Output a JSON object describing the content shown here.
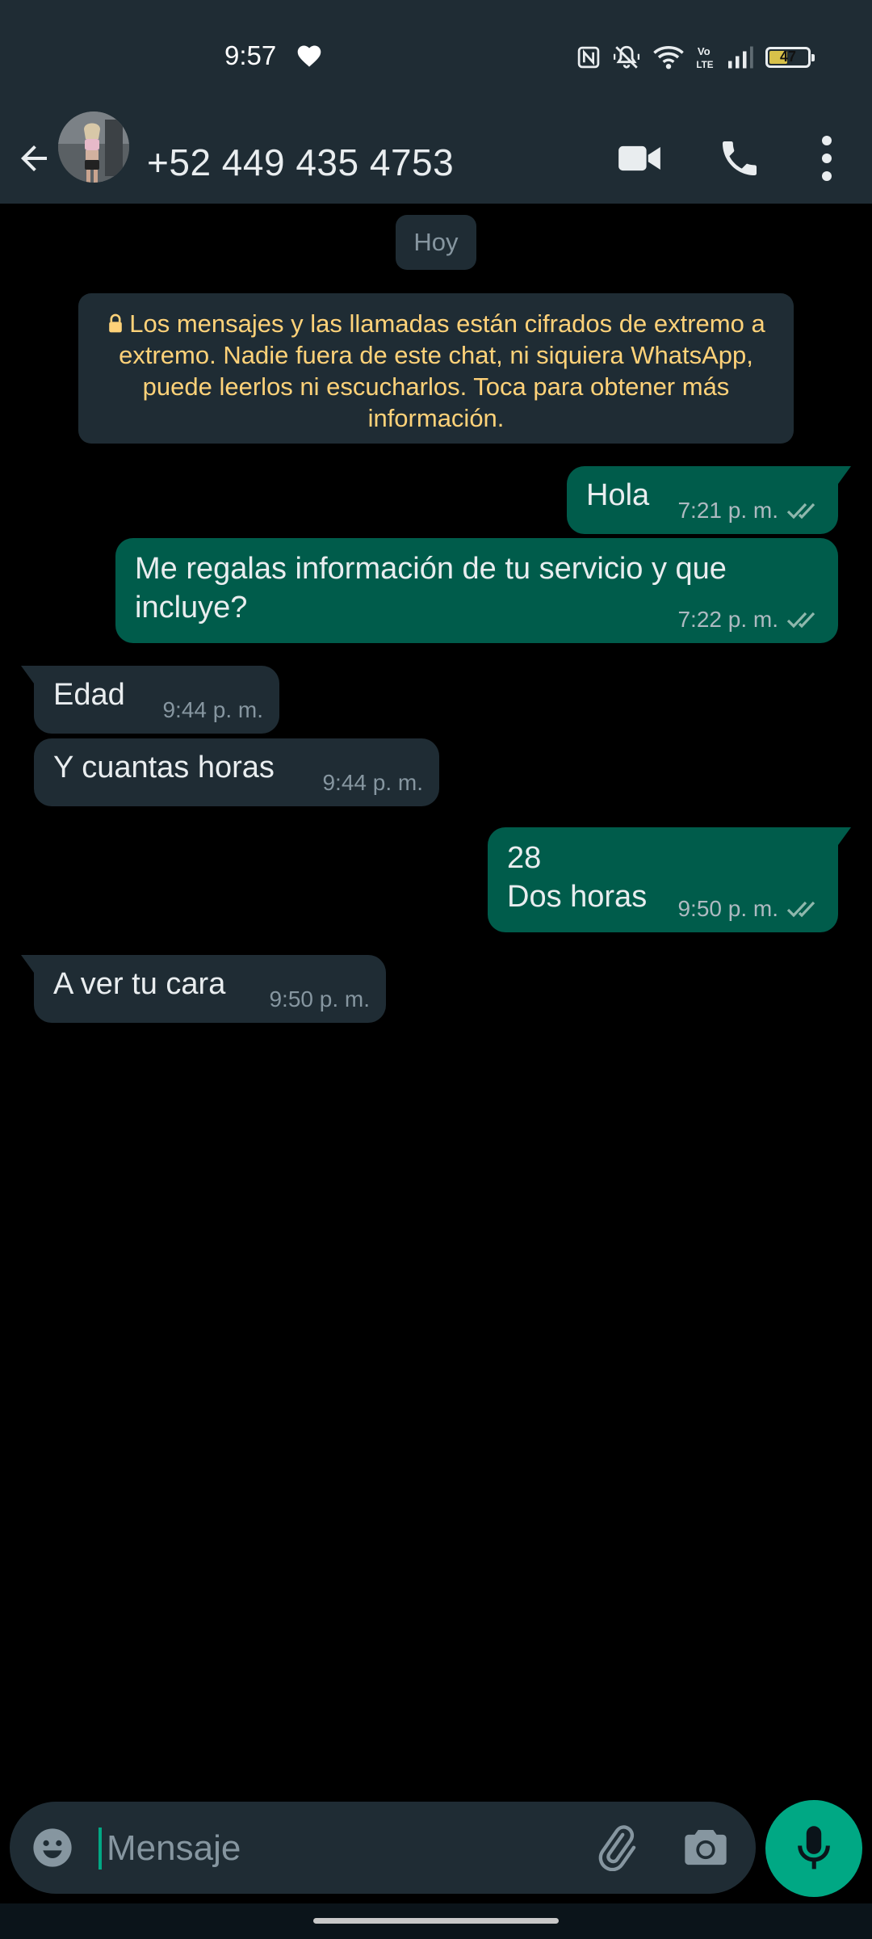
{
  "status_bar": {
    "time": "9:57",
    "battery_level": "47",
    "icons": [
      "heart-icon",
      "nfc-icon",
      "vibrate-off-icon",
      "wifi-icon",
      "volte-icon",
      "signal-icon",
      "battery-icon"
    ]
  },
  "header": {
    "contact": "+52 449 435 4753",
    "icons": [
      "back-arrow-icon",
      "avatar",
      "video-call-icon",
      "phone-icon",
      "more-vert-icon"
    ]
  },
  "chat": {
    "date_chip": "Hoy",
    "encryption_notice": "Los mensajes y las llamadas están cifrados de extremo a extremo. Nadie fuera de este chat, ni siquiera WhatsApp, puede leerlos ni escucharlos. Toca para obtener más información.",
    "messages": [
      {
        "direction": "out",
        "text": "Hola",
        "time": "7:21 p. m.",
        "status": "read"
      },
      {
        "direction": "out",
        "text": "Me regalas información de tu servicio y que incluye?",
        "time": "7:22 p. m.",
        "status": "read"
      },
      {
        "direction": "in",
        "text": "Edad",
        "time": "9:44 p. m."
      },
      {
        "direction": "in",
        "text": "Y cuantas horas",
        "time": "9:44 p. m."
      },
      {
        "direction": "out",
        "line1": "28",
        "line2": "Dos horas",
        "time": "9:50 p. m.",
        "status": "read"
      },
      {
        "direction": "in",
        "text": "A ver tu cara",
        "time": "9:50 p. m."
      }
    ]
  },
  "composer": {
    "placeholder": "Mensaje",
    "icons": [
      "emoji-icon",
      "attach-icon",
      "camera-icon",
      "mic-icon"
    ]
  },
  "colors": {
    "header_bg": "#1f2c34",
    "chat_bg": "#000000",
    "outgoing_bubble": "#005c4b",
    "incoming_bubble": "#1f2c34",
    "accent": "#00a884",
    "encryption_text": "#ffd279",
    "read_ticks": "#8696a0"
  }
}
